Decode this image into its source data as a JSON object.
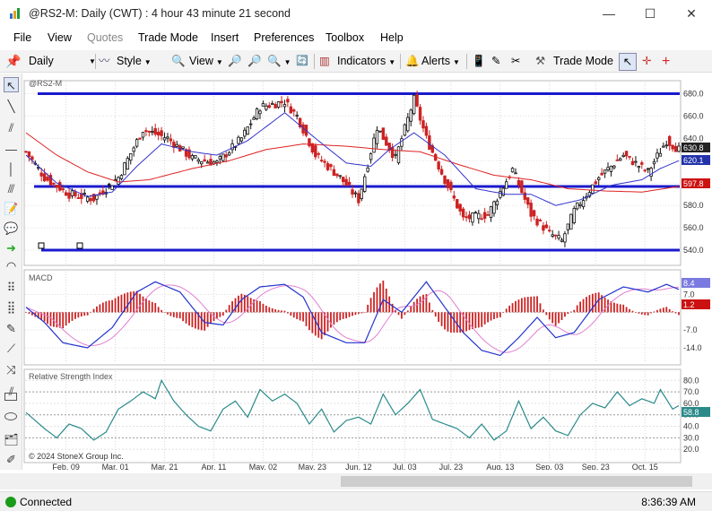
{
  "window": {
    "title": "@RS2-M: Daily (CWT) : 4 hour 43 minute 21 second",
    "minimize": "—",
    "maximize": "☐",
    "close": "✕"
  },
  "menu": [
    "File",
    "View",
    "Quotes",
    "Trade Mode",
    "Insert",
    "Preferences",
    "Toolbox",
    "Help"
  ],
  "menu_disabled": [
    "Quotes"
  ],
  "toolbar": {
    "interval": "Daily",
    "style": "Style",
    "view": "View",
    "indicators": "Indicators",
    "alerts": "Alerts",
    "trade_mode": "Trade Mode"
  },
  "panes": {
    "price_label": "@RS2-M",
    "macd_label": "MACD",
    "rsi_label": "Relative Strength Index",
    "copyright": "© 2024 StoneX Group Inc."
  },
  "price_axis": [
    "680.0",
    "660.0",
    "640.0",
    "620.0",
    "600.0",
    "580.0",
    "560.0",
    "540.0"
  ],
  "price_badges": {
    "last": "630.8",
    "ma_fast": "620.1",
    "ma_slow": "597.8"
  },
  "macd_axis": [
    "7.0",
    "-7.0",
    "-14.0"
  ],
  "macd_badges": {
    "macd": "8.4",
    "hist": "1.2"
  },
  "rsi_axis": [
    "80.0",
    "70.0",
    "60.0",
    "50.0",
    "40.0",
    "30.0",
    "20.0"
  ],
  "rsi_badge": "58.8",
  "dates": [
    "Feb, 09",
    "Mar, 01",
    "Mar, 21",
    "Apr, 11",
    "May, 02",
    "May, 23",
    "Jun, 12",
    "Jul, 03",
    "Jul, 23",
    "Aug, 13",
    "Sep, 03",
    "Sep, 23",
    "Oct, 15"
  ],
  "status": {
    "connection": "Connected",
    "time": "8:36:39 AM"
  },
  "colors": {
    "up": "#111111",
    "down": "#cc2222",
    "ma_fast": "#3333cc",
    "ma_slow": "#dd2222",
    "hline": "#1a1acc",
    "macd_line": "#2233cc",
    "signal": "#e080d0",
    "rsi": "#2a8a8a"
  },
  "chart_data": {
    "type": "line",
    "title": "@RS2-M",
    "ylim": [
      528,
      690
    ],
    "horizontal_lines": [
      680,
      597,
      540
    ],
    "close_anchors": [
      [
        0,
        628
      ],
      [
        6,
        605
      ],
      [
        14,
        590
      ],
      [
        22,
        586
      ],
      [
        30,
        605
      ],
      [
        38,
        648
      ],
      [
        46,
        640
      ],
      [
        54,
        622
      ],
      [
        62,
        618
      ],
      [
        70,
        640
      ],
      [
        76,
        668
      ],
      [
        84,
        673
      ],
      [
        88,
        660
      ],
      [
        94,
        625
      ],
      [
        102,
        605
      ],
      [
        108,
        585
      ],
      [
        114,
        650
      ],
      [
        120,
        622
      ],
      [
        126,
        675
      ],
      [
        130,
        640
      ],
      [
        136,
        603
      ],
      [
        142,
        568
      ],
      [
        150,
        572
      ],
      [
        158,
        612
      ],
      [
        164,
        572
      ],
      [
        170,
        555
      ],
      [
        174,
        548
      ],
      [
        178,
        575
      ],
      [
        186,
        605
      ],
      [
        194,
        625
      ],
      [
        202,
        610
      ],
      [
        208,
        638
      ],
      [
        212,
        630
      ]
    ],
    "ma_fast_anchors": [
      [
        0,
        625
      ],
      [
        10,
        600
      ],
      [
        20,
        588
      ],
      [
        28,
        592
      ],
      [
        36,
        615
      ],
      [
        44,
        635
      ],
      [
        54,
        628
      ],
      [
        62,
        625
      ],
      [
        72,
        638
      ],
      [
        84,
        663
      ],
      [
        94,
        640
      ],
      [
        104,
        618
      ],
      [
        112,
        615
      ],
      [
        118,
        630
      ],
      [
        126,
        645
      ],
      [
        136,
        625
      ],
      [
        146,
        595
      ],
      [
        156,
        590
      ],
      [
        164,
        590
      ],
      [
        172,
        580
      ],
      [
        180,
        585
      ],
      [
        190,
        598
      ],
      [
        200,
        603
      ],
      [
        206,
        613
      ],
      [
        212,
        620
      ]
    ],
    "ma_slow_anchors": [
      [
        0,
        645
      ],
      [
        10,
        625
      ],
      [
        20,
        610
      ],
      [
        30,
        601
      ],
      [
        40,
        603
      ],
      [
        54,
        613
      ],
      [
        66,
        620
      ],
      [
        78,
        630
      ],
      [
        90,
        635
      ],
      [
        104,
        633
      ],
      [
        116,
        630
      ],
      [
        128,
        628
      ],
      [
        140,
        617
      ],
      [
        152,
        607
      ],
      [
        164,
        603
      ],
      [
        176,
        595
      ],
      [
        188,
        593
      ],
      [
        200,
        592
      ],
      [
        212,
        597
      ]
    ],
    "macd_anchors": [
      [
        0,
        2
      ],
      [
        6,
        -4
      ],
      [
        12,
        -12
      ],
      [
        20,
        -14
      ],
      [
        28,
        -6
      ],
      [
        36,
        8
      ],
      [
        42,
        12
      ],
      [
        50,
        8
      ],
      [
        58,
        -4
      ],
      [
        64,
        -5
      ],
      [
        70,
        5
      ],
      [
        76,
        10
      ],
      [
        84,
        11
      ],
      [
        90,
        6
      ],
      [
        96,
        -8
      ],
      [
        104,
        -12
      ],
      [
        110,
        -12
      ],
      [
        116,
        5
      ],
      [
        122,
        0
      ],
      [
        130,
        12
      ],
      [
        136,
        2
      ],
      [
        142,
        -8
      ],
      [
        148,
        -15
      ],
      [
        154,
        -17
      ],
      [
        160,
        -10
      ],
      [
        166,
        -2
      ],
      [
        172,
        -10
      ],
      [
        178,
        -8
      ],
      [
        186,
        5
      ],
      [
        194,
        10
      ],
      [
        202,
        8
      ],
      [
        208,
        11
      ],
      [
        212,
        9
      ]
    ],
    "rsi_anchors": [
      [
        0,
        52
      ],
      [
        6,
        38
      ],
      [
        10,
        30
      ],
      [
        14,
        42
      ],
      [
        18,
        38
      ],
      [
        22,
        28
      ],
      [
        26,
        35
      ],
      [
        30,
        55
      ],
      [
        34,
        62
      ],
      [
        38,
        70
      ],
      [
        42,
        64
      ],
      [
        44,
        80
      ],
      [
        48,
        62
      ],
      [
        52,
        50
      ],
      [
        56,
        40
      ],
      [
        60,
        36
      ],
      [
        64,
        55
      ],
      [
        68,
        62
      ],
      [
        72,
        48
      ],
      [
        76,
        72
      ],
      [
        80,
        62
      ],
      [
        84,
        68
      ],
      [
        88,
        60
      ],
      [
        92,
        42
      ],
      [
        96,
        55
      ],
      [
        100,
        35
      ],
      [
        104,
        45
      ],
      [
        108,
        48
      ],
      [
        112,
        42
      ],
      [
        116,
        68
      ],
      [
        120,
        50
      ],
      [
        124,
        60
      ],
      [
        128,
        72
      ],
      [
        132,
        46
      ],
      [
        136,
        42
      ],
      [
        140,
        38
      ],
      [
        144,
        30
      ],
      [
        148,
        42
      ],
      [
        152,
        28
      ],
      [
        156,
        36
      ],
      [
        160,
        62
      ],
      [
        164,
        38
      ],
      [
        168,
        48
      ],
      [
        172,
        36
      ],
      [
        176,
        32
      ],
      [
        180,
        50
      ],
      [
        184,
        60
      ],
      [
        188,
        56
      ],
      [
        192,
        70
      ],
      [
        196,
        58
      ],
      [
        200,
        64
      ],
      [
        204,
        60
      ],
      [
        206,
        72
      ],
      [
        210,
        55
      ],
      [
        212,
        58
      ]
    ]
  }
}
